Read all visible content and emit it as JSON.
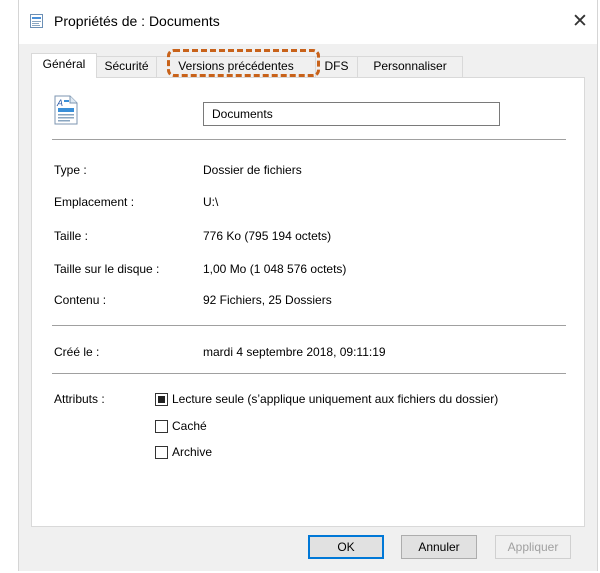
{
  "window": {
    "title": "Propriétés de : Documents",
    "close_glyph": "✕"
  },
  "tabs": [
    {
      "label": "Général",
      "active": true
    },
    {
      "label": "Sécurité",
      "active": false
    },
    {
      "label": "Versions précédentes",
      "active": false
    },
    {
      "label": "DFS",
      "active": false
    },
    {
      "label": "Personnaliser",
      "active": false
    }
  ],
  "general": {
    "folder_name": "Documents",
    "folder_icon": "document-folder-icon",
    "properties": [
      {
        "label": "Type :",
        "value": "Dossier de fichiers"
      },
      {
        "label": "Emplacement :",
        "value": "U:\\"
      },
      {
        "label": "Taille :",
        "value": "776 Ko (795 194 octets)"
      },
      {
        "label": "Taille sur le disque :",
        "value": "1,00 Mo (1 048 576 octets)"
      },
      {
        "label": "Contenu :",
        "value": "92 Fichiers, 25 Dossiers"
      }
    ],
    "created": {
      "label": "Créé le :",
      "value": "mardi 4 septembre 2018, 09:11:19"
    },
    "attributes": {
      "label": "Attributs :",
      "items": [
        {
          "label": "Lecture seule (s’applique uniquement aux fichiers du dossier)",
          "checked": true
        },
        {
          "label": "Caché",
          "checked": false
        },
        {
          "label": "Archive",
          "checked": false
        }
      ]
    }
  },
  "buttons": {
    "ok": "OK",
    "cancel": "Annuler",
    "apply": "Appliquer"
  },
  "colors": {
    "highlight": "#c8621a",
    "focus_border": "#0078d7"
  }
}
